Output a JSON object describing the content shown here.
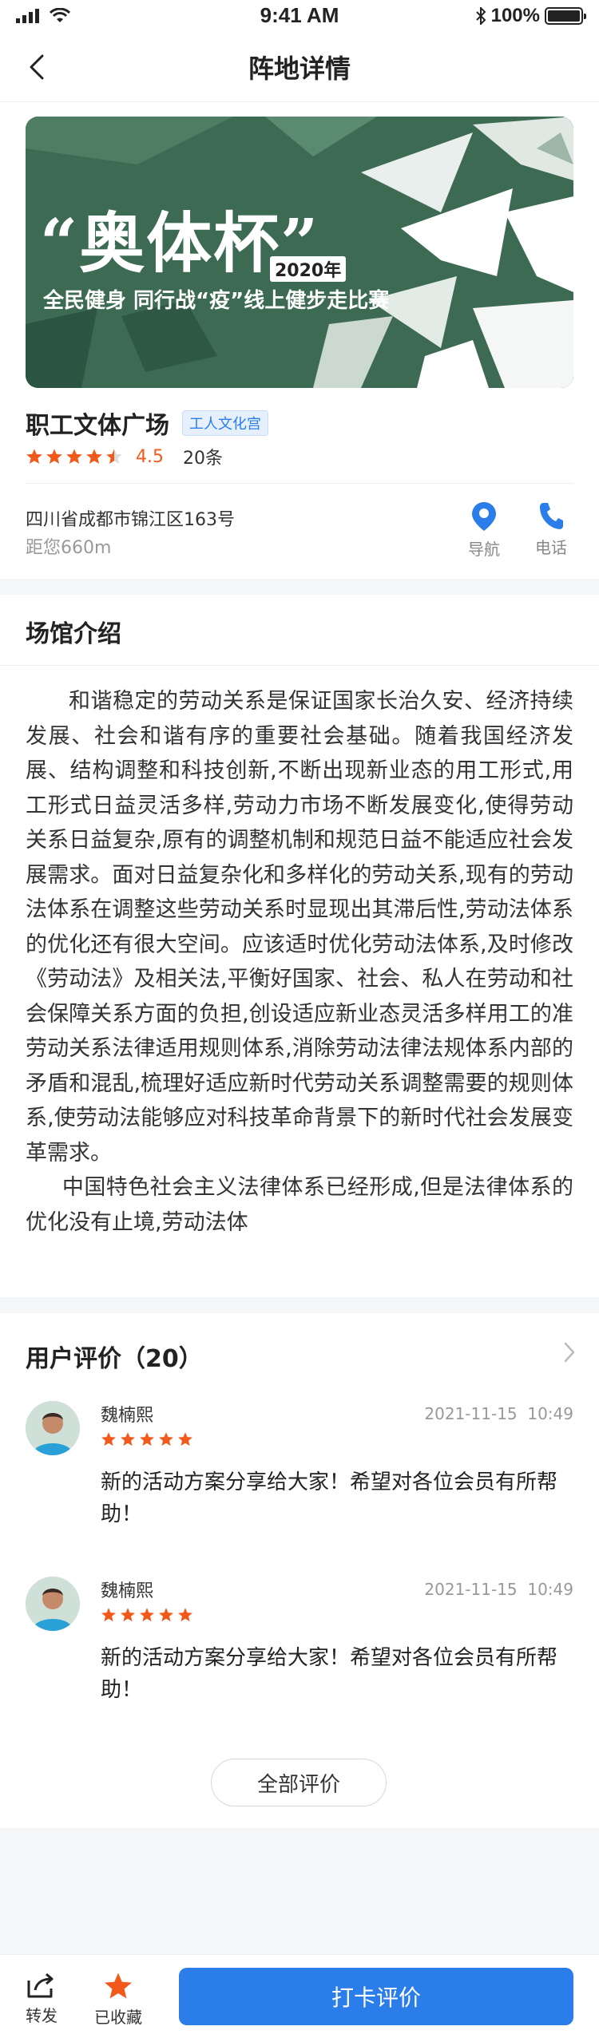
{
  "status_bar": {
    "time": "9:41 AM",
    "battery": "100%"
  },
  "nav": {
    "title": "阵地详情"
  },
  "banner": {
    "title": "“奥体杯”",
    "year": "2020年",
    "subtitle": "全民健身 同行战“疫”线上健步走比赛",
    "corner_tag": ""
  },
  "venue": {
    "name": "职工文体广场",
    "tag": "工人文化宫",
    "rating": "4.5",
    "rating_count": "20条",
    "stars": 4.5,
    "address": "四川省成都市锦江区163号",
    "distance": "距您660m",
    "nav_label": "导航",
    "phone_label": "电话"
  },
  "intro": {
    "title": "场馆介绍",
    "paragraphs": [
      "和谐稳定的劳动关系是保证国家长治久安、经济持续发展、社会和谐有序的重要社会基础。随着我国经济发展、结构调整和科技创新,不断出现新业态的用工形式,用工形式日益灵活多样,劳动力市场不断发展变化,使得劳动关系日益复杂,原有的调整机制和规范日益不能适应社会发展需求。面对日益复杂化和多样化的劳动关系,现有的劳动法体系在调整这些劳动关系时显现出其滞后性,劳动法体系的优化还有很大空间。应该适时优化劳动法体系,及时修改《劳动法》及相关法,平衡好国家、社会、私人在劳动和社会保障关系方面的负担,创设适应新业态灵活多样用工的准劳动关系法律适用规则体系,消除劳动法律法规体系内部的矛盾和混乱,梳理好适应新时代劳动关系调整需要的规则体系,使劳动法能够应对科技革命背景下的新时代社会发展变革需求。",
      "中国特色社会主义法律体系已经形成,但是法律体系的优化没有止境,劳动法体"
    ]
  },
  "reviews": {
    "title": "用户评价（20）",
    "all_label": "全部评价",
    "items": [
      {
        "name": "魏楠熙",
        "date": "2021-11-15",
        "time": "10:49",
        "stars": 5,
        "body": "新的活动方案分享给大家！希望对各位会员有所帮助！"
      },
      {
        "name": "魏楠熙",
        "date": "2021-11-15",
        "time": "10:49",
        "stars": 5,
        "body": "新的活动方案分享给大家！希望对各位会员有所帮助！"
      }
    ]
  },
  "bottom_bar": {
    "share_label": "转发",
    "fav_label": "已收藏",
    "cta_label": "打卡评价"
  },
  "colors": {
    "accent": "#2b7de9",
    "star": "#f25a1b",
    "banner_green": "#3c6a52"
  }
}
